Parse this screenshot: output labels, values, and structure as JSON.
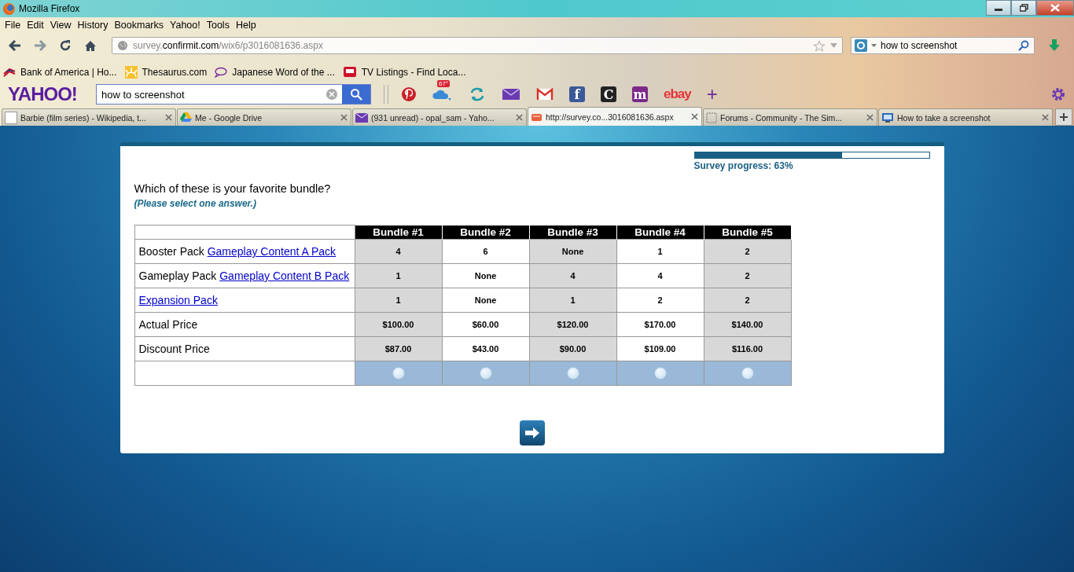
{
  "window": {
    "title": "Mozilla Firefox"
  },
  "menu": [
    "File",
    "Edit",
    "View",
    "History",
    "Bookmarks",
    "Yahoo!",
    "Tools",
    "Help"
  ],
  "address": {
    "prefix": "survey.",
    "domain": "confirmit.com",
    "path": "/wix6/p3016081636.aspx"
  },
  "web_search": {
    "value": "how to screenshot"
  },
  "bookmarks": [
    "Bank of America | Ho...",
    "Thesaurus.com",
    "Japanese Word of the ...",
    "TV Listings - Find Loca..."
  ],
  "yahoo_toolbar": {
    "logo": "YAHOO!",
    "search_value": "how to screenshot",
    "buttons": [
      {
        "kind": "pin"
      },
      {
        "kind": "weather",
        "text": "67°"
      },
      {
        "kind": "sync"
      },
      {
        "kind": "mail"
      },
      {
        "kind": "gmail"
      },
      {
        "kind": "glyph",
        "text": "f",
        "color": "#3b5998"
      },
      {
        "kind": "glyph",
        "text": "C",
        "color": "#222222"
      },
      {
        "kind": "glyph",
        "text": "m",
        "color": "#7a2a8a"
      },
      {
        "kind": "wordmark",
        "text": "ebay"
      },
      {
        "kind": "plus",
        "text": "+"
      }
    ]
  },
  "tabs": [
    {
      "label": "Barbie (film series) - Wikipedia, t...",
      "selected": false
    },
    {
      "label": "Me - Google Drive",
      "selected": false
    },
    {
      "label": "(931 unread) - opal_sam - Yaho...",
      "selected": false
    },
    {
      "label": "http://survey.co...3016081636.aspx",
      "selected": true
    },
    {
      "label": "Forums - Community - The Sim...",
      "selected": false
    },
    {
      "label": "How to take a screenshot",
      "selected": false
    }
  ],
  "survey": {
    "progress": {
      "level": 0.63,
      "label": "Survey progress: 63%"
    },
    "question": "Which of these is your favorite bundle?",
    "instruction": "(Please select one answer.)",
    "table": {
      "columns": [
        "Bundle #1",
        "Bundle #2",
        "Bundle #3",
        "Bundle #4",
        "Bundle #5"
      ],
      "rows": [
        {
          "label": "Booster Pack",
          "link": "Gameplay Content A Pack",
          "cells": [
            "4",
            "6",
            "None",
            "1",
            "2"
          ]
        },
        {
          "label": "Gameplay Pack",
          "link": "Gameplay Content B Pack",
          "cells": [
            "1",
            "None",
            "4",
            "4",
            "2"
          ]
        },
        {
          "link": "Expansion Pack",
          "cells": [
            "1",
            "None",
            "1",
            "2",
            "2"
          ]
        },
        {
          "label": "Actual Price",
          "cells": [
            "$100.00",
            "$60.00",
            "$120.00",
            "$170.00",
            "$140.00"
          ]
        },
        {
          "label": "Discount Price",
          "cells": [
            "$87.00",
            "$43.00",
            "$90.00",
            "$109.00",
            "$116.00"
          ]
        }
      ],
      "choices": [
        {
          "selected": false
        },
        {
          "selected": false
        },
        {
          "selected": false
        },
        {
          "selected": false
        },
        {
          "selected": false
        }
      ]
    }
  }
}
